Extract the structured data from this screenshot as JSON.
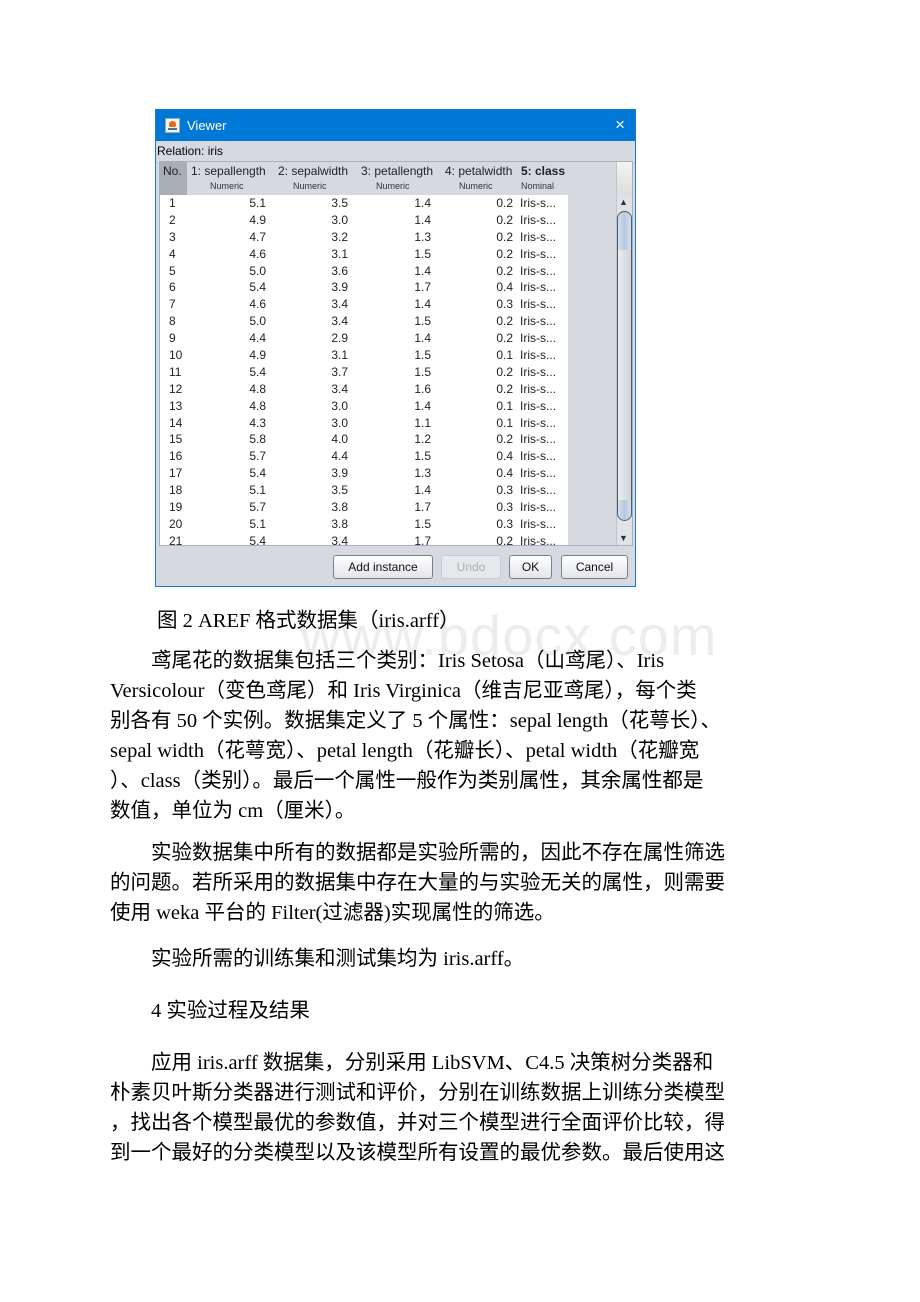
{
  "viewer": {
    "title": "Viewer",
    "close_icon": "×",
    "relation_label": "Relation: iris",
    "columns": [
      {
        "name": "No.",
        "type": ""
      },
      {
        "name": "1: sepallength",
        "type": "Numeric"
      },
      {
        "name": "2: sepalwidth",
        "type": "Numeric"
      },
      {
        "name": "3: petallength",
        "type": "Numeric"
      },
      {
        "name": "4: petalwidth",
        "type": "Numeric"
      },
      {
        "name": "5: class",
        "type": "Nominal"
      }
    ],
    "rows": [
      [
        "1",
        "5.1",
        "3.5",
        "1.4",
        "0.2",
        "Iris-s..."
      ],
      [
        "2",
        "4.9",
        "3.0",
        "1.4",
        "0.2",
        "Iris-s..."
      ],
      [
        "3",
        "4.7",
        "3.2",
        "1.3",
        "0.2",
        "Iris-s..."
      ],
      [
        "4",
        "4.6",
        "3.1",
        "1.5",
        "0.2",
        "Iris-s..."
      ],
      [
        "5",
        "5.0",
        "3.6",
        "1.4",
        "0.2",
        "Iris-s..."
      ],
      [
        "6",
        "5.4",
        "3.9",
        "1.7",
        "0.4",
        "Iris-s..."
      ],
      [
        "7",
        "4.6",
        "3.4",
        "1.4",
        "0.3",
        "Iris-s..."
      ],
      [
        "8",
        "5.0",
        "3.4",
        "1.5",
        "0.2",
        "Iris-s..."
      ],
      [
        "9",
        "4.4",
        "2.9",
        "1.4",
        "0.2",
        "Iris-s..."
      ],
      [
        "10",
        "4.9",
        "3.1",
        "1.5",
        "0.1",
        "Iris-s..."
      ],
      [
        "11",
        "5.4",
        "3.7",
        "1.5",
        "0.2",
        "Iris-s..."
      ],
      [
        "12",
        "4.8",
        "3.4",
        "1.6",
        "0.2",
        "Iris-s..."
      ],
      [
        "13",
        "4.8",
        "3.0",
        "1.4",
        "0.1",
        "Iris-s..."
      ],
      [
        "14",
        "4.3",
        "3.0",
        "1.1",
        "0.1",
        "Iris-s..."
      ],
      [
        "15",
        "5.8",
        "4.0",
        "1.2",
        "0.2",
        "Iris-s..."
      ],
      [
        "16",
        "5.7",
        "4.4",
        "1.5",
        "0.4",
        "Iris-s..."
      ],
      [
        "17",
        "5.4",
        "3.9",
        "1.3",
        "0.4",
        "Iris-s..."
      ],
      [
        "18",
        "5.1",
        "3.5",
        "1.4",
        "0.3",
        "Iris-s..."
      ],
      [
        "19",
        "5.7",
        "3.8",
        "1.7",
        "0.3",
        "Iris-s..."
      ],
      [
        "20",
        "5.1",
        "3.8",
        "1.5",
        "0.3",
        "Iris-s..."
      ],
      [
        "21",
        "5.4",
        "3.4",
        "1.7",
        "0.2",
        "Iris-s..."
      ]
    ],
    "scroll_up_icon": "▲",
    "scroll_down_icon": "▼",
    "buttons": {
      "add_instance": "Add instance",
      "undo": "Undo",
      "ok": "OK",
      "cancel": "Cancel"
    }
  },
  "document": {
    "caption": "图 2 AREF 格式数据集（iris.arff）",
    "watermark": "www.bdocx.com",
    "paragraph1": [
      "　　鸢尾花的数据集包括三个类别：Iris Setosa（山鸢尾）、Iris",
      "Versicolour（变色鸢尾）和 Iris Virginica（维吉尼亚鸢尾），每个类",
      "别各有 50 个实例。数据集定义了 5 个属性：sepal length（花萼长）、",
      "sepal width（花萼宽）、petal length（花瓣长）、petal width（花瓣宽",
      "）、class（类别）。最后一个属性一般作为类别属性，其余属性都是",
      "数值，单位为 cm（厘米）。"
    ],
    "paragraph2": [
      "　　实验数据集中所有的数据都是实验所需的，因此不存在属性筛选",
      "的问题。若所采用的数据集中存在大量的与实验无关的属性，则需要",
      "使用 weka 平台的 Filter(过滤器)实现属性的筛选。"
    ],
    "paragraph3": "　　实验所需的训练集和测试集均为 iris.arff。",
    "heading4": "　　4 实验过程及结果",
    "paragraph4": [
      "　　应用 iris.arff 数据集，分别采用 LibSVM、C4.5 决策树分类器和",
      "朴素贝叶斯分类器进行测试和评价，分别在训练数据上训练分类模型",
      "，找出各个模型最优的参数值，并对三个模型进行全面评价比较，得",
      "到一个最好的分类模型以及该模型所有设置的最优参数。最后使用这"
    ]
  }
}
